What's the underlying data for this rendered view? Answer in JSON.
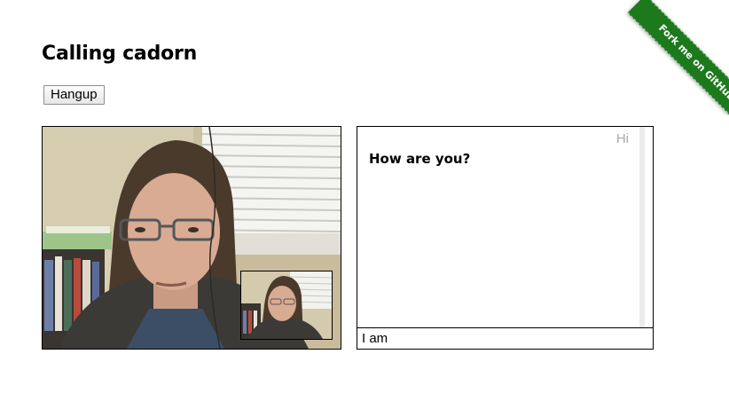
{
  "page": {
    "title": "Calling cadorn"
  },
  "controls": {
    "hangup_label": "Hangup"
  },
  "chat": {
    "messages": [
      {
        "from": "remote",
        "text": "Hi"
      },
      {
        "from": "local",
        "text": "How are you?"
      }
    ],
    "input_value": "I am"
  },
  "ribbon": {
    "label": "Fork me on GitHub",
    "color": "#1c7a1c"
  }
}
